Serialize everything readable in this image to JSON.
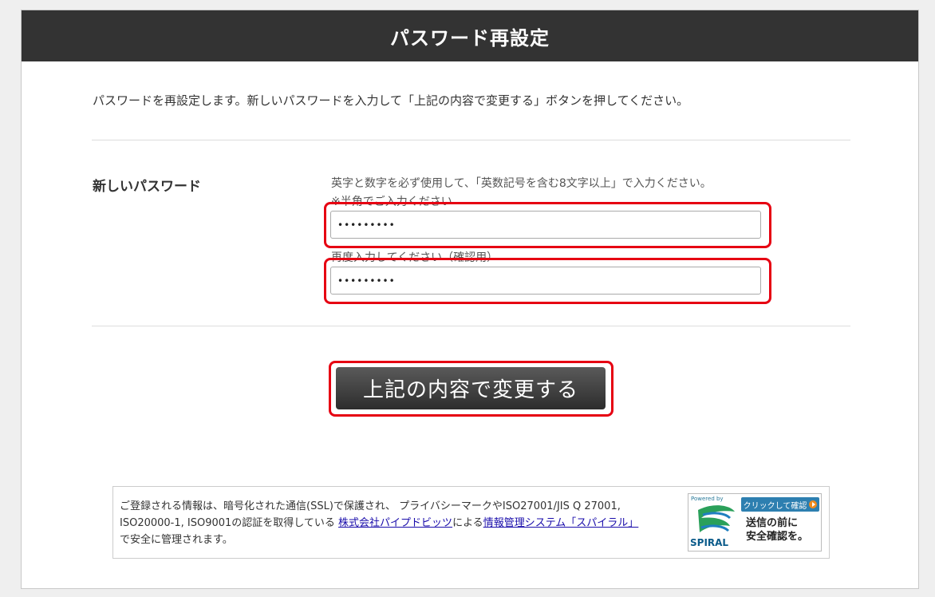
{
  "header": {
    "title": "パスワード再設定"
  },
  "intro": {
    "text": "パスワードを再設定します。新しいパスワードを入力して「上記の内容で変更する」ボタンを押してください。"
  },
  "password": {
    "label": "新しいパスワード",
    "hint": "英字と数字を必ず使用して、「英数記号を含む8文字以上」で入力ください。",
    "hint_halfwidth": "※半角でご入力ください",
    "value": "•••••••••",
    "confirm_hint": "再度入力してください（確認用）",
    "confirm_value": "•••••••••"
  },
  "submit": {
    "label": "上記の内容で変更する"
  },
  "notice": {
    "text_1": "ご登録される情報は、暗号化された通信(SSL)で保護され、 プライバシーマークやISO27001/JIS Q 27001, ISO20000-1, ISO9001の認証を取得している ",
    "link_company": "株式会社パイプドビッツ",
    "text_2": "による",
    "link_system": "情報管理システム「スパイラル」",
    "text_3": "で安全に管理されます。"
  },
  "badge": {
    "powered": "Powered by",
    "brand": "SPIRAL",
    "click": "クリックして確認",
    "message_1": "送信の前に",
    "message_2": "安全確認を。"
  },
  "colors": {
    "header_bg": "#333333",
    "highlight": "#e60012",
    "link": "#1a0dab"
  }
}
